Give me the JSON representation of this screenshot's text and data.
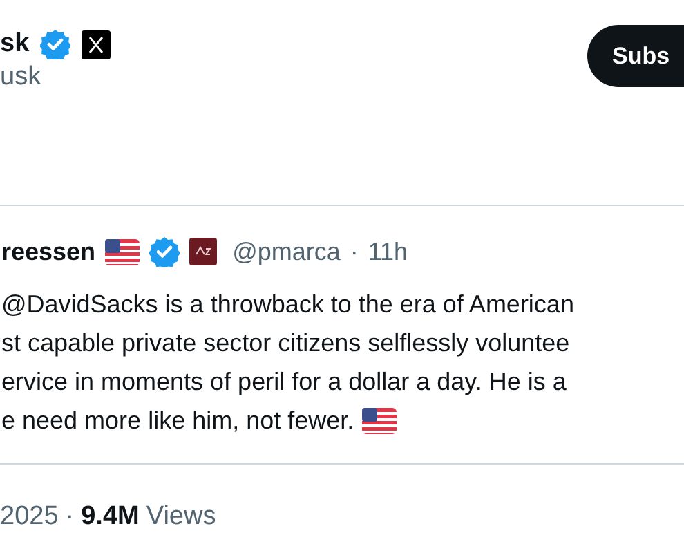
{
  "author": {
    "name": "sk",
    "verified": true,
    "handle": "usk"
  },
  "subscribe_button": "Subs",
  "quoted_post": {
    "author": "reessen",
    "verified": true,
    "handle": "@pmarca",
    "separator": "·",
    "time": "11h",
    "lines": [
      "@DavidSacks is a throwback to the era of American",
      "st capable private sector citizens selflessly voluntee",
      "ervice in moments of peril for a dollar a day. He is a",
      "e need more like him, not fewer."
    ]
  },
  "meta": {
    "date": "2025",
    "separator": "·",
    "views_count": "9.4M",
    "views_label": "Views"
  }
}
